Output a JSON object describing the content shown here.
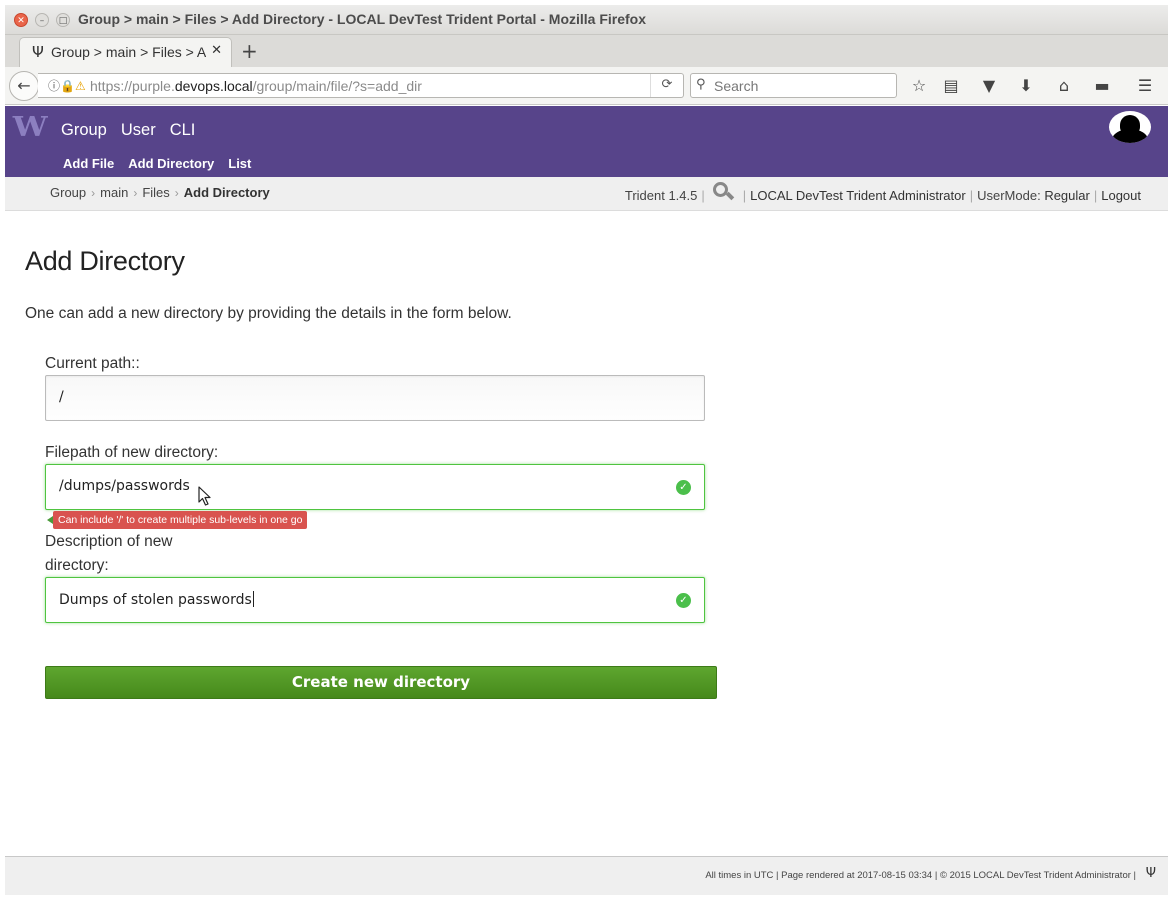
{
  "window": {
    "title": "Group > main > Files > Add Directory - LOCAL DevTest Trident Portal - Mozilla Firefox",
    "controls": {
      "close": "✕",
      "minimize": "–",
      "maximize": "□"
    }
  },
  "browser": {
    "tab": {
      "favicon": "Ψ",
      "title": "Group > main > Files > Add Directory",
      "close": "✕"
    },
    "new_tab": "+",
    "url": {
      "prefix": "https://purple.",
      "host": "devops.local",
      "path": "/group/main/file/?s=add_dir"
    },
    "search_placeholder": "Search",
    "toolbar_icons": [
      "star-icon",
      "reading-list-icon",
      "pocket-icon",
      "download-icon",
      "home-icon",
      "extension-icon",
      "menu-icon"
    ]
  },
  "site": {
    "logo": "W",
    "main_menu": [
      "Group",
      "User",
      "CLI"
    ],
    "sub_menu": [
      "Add File",
      "Add Directory",
      "List"
    ],
    "breadcrumb": [
      "Group",
      "main",
      "Files",
      "Add Directory"
    ],
    "version": "Trident 1.4.5",
    "admin": "LOCAL DevTest Trident Administrator",
    "usermode_label": "UserMode:",
    "usermode_value": "Regular",
    "logout": "Logout"
  },
  "form": {
    "heading": "Add Directory",
    "intro": "One can add a new directory by providing the details in the form below.",
    "current_path_label": "Current path::",
    "current_path_value": "/",
    "filepath_label": "Filepath of new directory:",
    "filepath_value": "/dumps/passwords",
    "filepath_hint": "Can include '/' to create multiple sub-levels in one go",
    "description_label_1": "Description of new",
    "description_label_2": "directory:",
    "description_value": "Dumps of stolen passwords",
    "submit_label": "Create new directory"
  },
  "footer": {
    "text": "All times in UTC | Page rendered at 2017-08-15 03:34 | © 2015 LOCAL DevTest Trident Administrator |",
    "logo": "Ψ"
  },
  "colors": {
    "brand": "#57448a",
    "valid": "#4fc440",
    "submit": "#4e931f",
    "hint": "#d9534f"
  }
}
